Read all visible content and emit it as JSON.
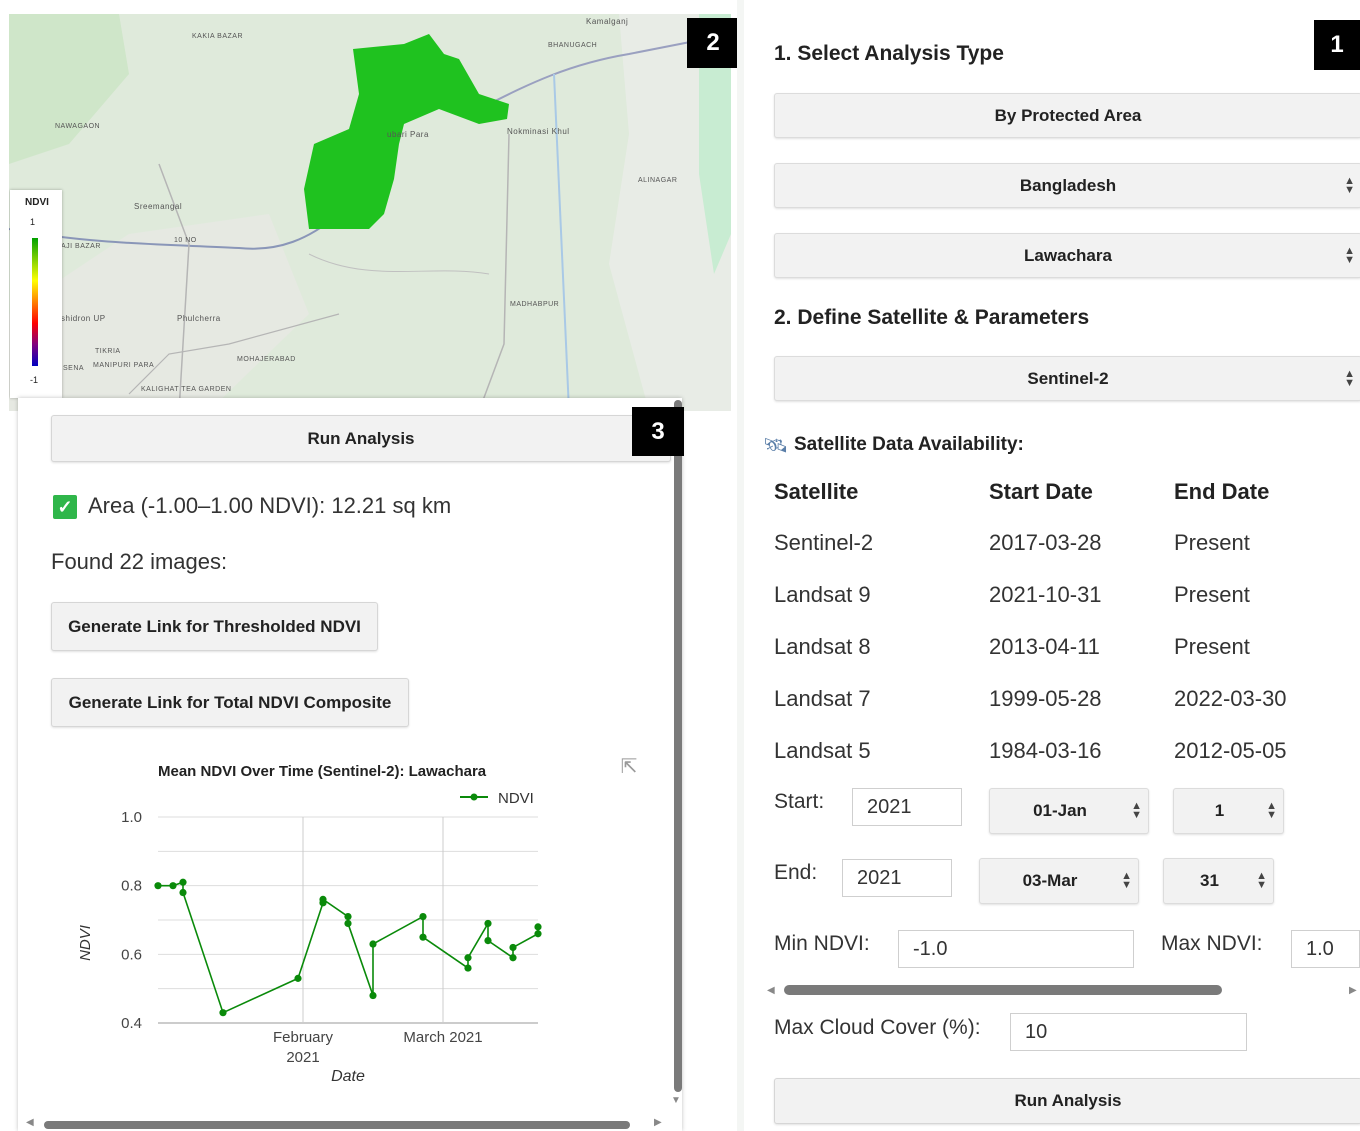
{
  "map": {
    "badge": "2",
    "place_labels": [
      "KAKIA BAZAR",
      "NAWAGAON",
      "Sreemangal",
      "AJI BAZAR",
      "10 NO",
      "shidron UP",
      "Phulcherra",
      "MOHAJERABAD",
      "MANIPURI PARA",
      "TIKRIA",
      "KALIGHAT TEA GARDEN",
      "Nokminasi Khul",
      "ALINAGAR",
      "MADHABPUR",
      "Kamalganj",
      "BHANUGACH",
      "ubari Para",
      "SENA"
    ],
    "legend": {
      "title": "NDVI",
      "max": "1",
      "min": "-1"
    },
    "colors": {
      "ndvi_area": "#1fc21f",
      "map_bg": "#dfeadb"
    }
  },
  "panel3": {
    "badge": "3",
    "run_button": "Run Analysis",
    "area_check_icon": "check-icon",
    "area_text": "Area (-1.00–1.00 NDVI): 12.21 sq km",
    "found_text": "Found 22 images:",
    "thresholded_button": "Generate Link for Thresholded NDVI",
    "composite_button": "Generate Link for Total NDVI Composite",
    "popout_icon": "external-link-icon"
  },
  "chart_data": {
    "type": "line",
    "title": "Mean NDVI Over Time (Sentinel-2): Lawachara",
    "xlabel": "Date",
    "ylabel": "NDVI",
    "ylim": [
      0.4,
      1.0
    ],
    "yticks": [
      "0.4",
      "0.6",
      "0.8",
      "1.0"
    ],
    "xtick_labels": [
      {
        "line1": "February",
        "line2": "2021",
        "date": "2021-02-01"
      },
      {
        "line1": "March 2021",
        "line2": "",
        "date": "2021-03-01"
      }
    ],
    "legend": "NDVI",
    "legend_position": "top-right",
    "color": "#0a8a0a",
    "series": [
      {
        "name": "NDVI",
        "x": [
          "2021-01-03",
          "2021-01-06",
          "2021-01-08",
          "2021-01-08",
          "2021-01-16",
          "2021-01-31",
          "2021-02-05",
          "2021-02-05",
          "2021-02-10",
          "2021-02-10",
          "2021-02-15",
          "2021-02-15",
          "2021-02-25",
          "2021-02-25",
          "2021-03-06",
          "2021-03-06",
          "2021-03-10",
          "2021-03-10",
          "2021-03-15",
          "2021-03-15",
          "2021-03-20",
          "2021-03-20"
        ],
        "values": [
          0.8,
          0.8,
          0.81,
          0.78,
          0.43,
          0.53,
          0.75,
          0.76,
          0.71,
          0.69,
          0.48,
          0.63,
          0.71,
          0.65,
          0.56,
          0.59,
          0.69,
          0.64,
          0.59,
          0.62,
          0.66,
          0.68
        ]
      }
    ]
  },
  "panel1": {
    "badge": "1",
    "section1": "1. Select Analysis Type",
    "analysis_type": "By Protected Area",
    "country": "Bangladesh",
    "area": "Lawachara",
    "section2": "2. Define Satellite & Parameters",
    "satellite": "Sentinel-2",
    "availability_icon": "satellite-icon",
    "availability_title": "Satellite Data Availability:",
    "table": {
      "headers": [
        "Satellite",
        "Start Date",
        "End Date"
      ],
      "rows": [
        [
          "Sentinel-2",
          "2017-03-28",
          "Present"
        ],
        [
          "Landsat 9",
          "2021-10-31",
          "Present"
        ],
        [
          "Landsat 8",
          "2013-04-11",
          "Present"
        ],
        [
          "Landsat 7",
          "1999-05-28",
          "2022-03-30"
        ],
        [
          "Landsat 5",
          "1984-03-16",
          "2012-05-05"
        ]
      ]
    },
    "start_label": "Start:",
    "start_year": "2021",
    "start_month": "01-Jan",
    "start_day": "1",
    "end_label": "End:",
    "end_year": "2021",
    "end_month": "03-Mar",
    "end_day": "31",
    "min_ndvi_label": "Min NDVI:",
    "min_ndvi": "-1.0",
    "max_ndvi_label": "Max NDVI:",
    "max_ndvi": "1.0",
    "cloud_label": "Max Cloud Cover (%):",
    "cloud_value": "10",
    "run_button": "Run Analysis"
  }
}
